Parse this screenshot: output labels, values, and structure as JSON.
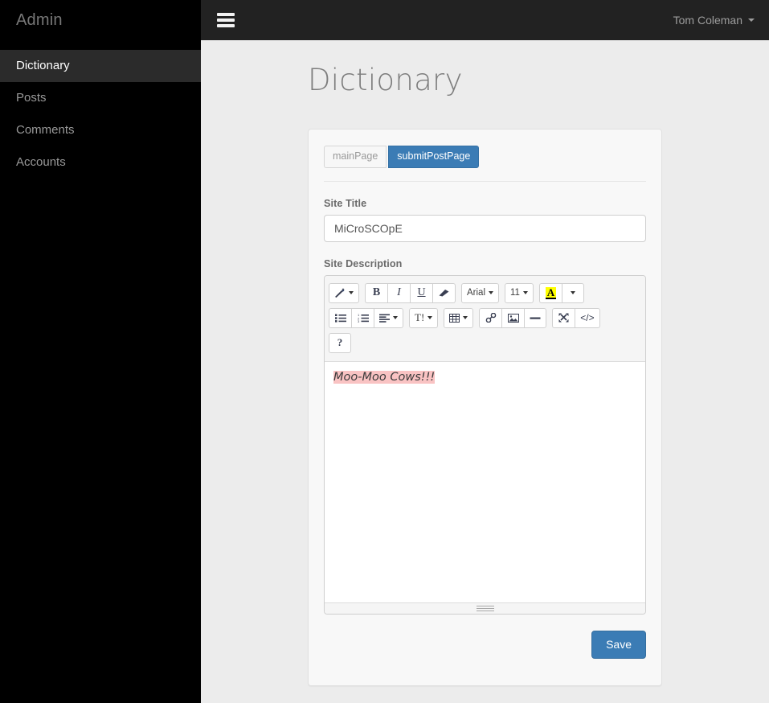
{
  "sidebar": {
    "brand": "Admin",
    "items": [
      {
        "label": "Dictionary",
        "active": true
      },
      {
        "label": "Posts",
        "active": false
      },
      {
        "label": "Comments",
        "active": false
      },
      {
        "label": "Accounts",
        "active": false
      }
    ]
  },
  "topbar": {
    "menu_icon": "hamburger-icon",
    "user_name": "Tom Coleman",
    "caret_icon": "caret-down-icon"
  },
  "page": {
    "title": "Dictionary"
  },
  "tabs": [
    {
      "label": "mainPage",
      "active": false
    },
    {
      "label": "submitPostPage",
      "active": true
    }
  ],
  "form": {
    "site_title": {
      "label": "Site Title",
      "value": "MiCroSCOpE",
      "placeholder": ""
    },
    "site_description": {
      "label": "Site Description",
      "content": "Moo-Moo Cows!!!",
      "highlight_color": "#f9c3c3"
    },
    "save_label": "Save"
  },
  "editor": {
    "toolbar_rows": [
      {
        "groups": [
          {
            "buttons": [
              {
                "icon": "magic-wand-icon",
                "label": "",
                "caret": true
              }
            ]
          },
          {
            "buttons": [
              {
                "icon": "bold-icon",
                "label": "B",
                "caret": false
              },
              {
                "icon": "italic-icon",
                "label": "I",
                "caret": false
              },
              {
                "icon": "underline-icon",
                "label": "U",
                "caret": false
              },
              {
                "icon": "eraser-icon",
                "label": "",
                "caret": false
              }
            ]
          },
          {
            "buttons": [
              {
                "icon": "font-name-icon",
                "label": "Arial",
                "caret": true
              }
            ]
          },
          {
            "buttons": [
              {
                "icon": "font-size-icon",
                "label": "11",
                "caret": true
              }
            ]
          },
          {
            "buttons": [
              {
                "icon": "recent-color-icon",
                "label": "A",
                "caret": false
              },
              {
                "icon": "color-dropdown-icon",
                "label": "",
                "caret": true
              }
            ]
          }
        ]
      },
      {
        "groups": [
          {
            "buttons": [
              {
                "icon": "unordered-list-icon",
                "label": "",
                "caret": false
              },
              {
                "icon": "ordered-list-icon",
                "label": "",
                "caret": false
              },
              {
                "icon": "paragraph-align-icon",
                "label": "",
                "caret": true
              }
            ]
          },
          {
            "buttons": [
              {
                "icon": "line-height-icon",
                "label": "T!",
                "caret": true
              }
            ]
          },
          {
            "buttons": [
              {
                "icon": "table-icon",
                "label": "",
                "caret": true
              }
            ]
          },
          {
            "buttons": [
              {
                "icon": "link-icon",
                "label": "",
                "caret": false
              },
              {
                "icon": "picture-icon",
                "label": "",
                "caret": false
              },
              {
                "icon": "horizontal-rule-icon",
                "label": "",
                "caret": false
              }
            ]
          },
          {
            "buttons": [
              {
                "icon": "fullscreen-icon",
                "label": "",
                "caret": false
              },
              {
                "icon": "code-view-icon",
                "label": "",
                "caret": false
              }
            ]
          }
        ]
      },
      {
        "groups": [
          {
            "buttons": [
              {
                "icon": "help-icon",
                "label": "?",
                "caret": false
              }
            ]
          }
        ]
      }
    ],
    "resize_handle": "resize-grip-icon"
  },
  "colors": {
    "sidebar_bg": "#000000",
    "sidebar_active_bg": "#2b2b2b",
    "topbar_bg": "#222222",
    "page_bg": "#ececec",
    "panel_bg": "#f8f8f8",
    "accent": "#3b7cb5",
    "highlight_yellow": "#ffff00"
  }
}
